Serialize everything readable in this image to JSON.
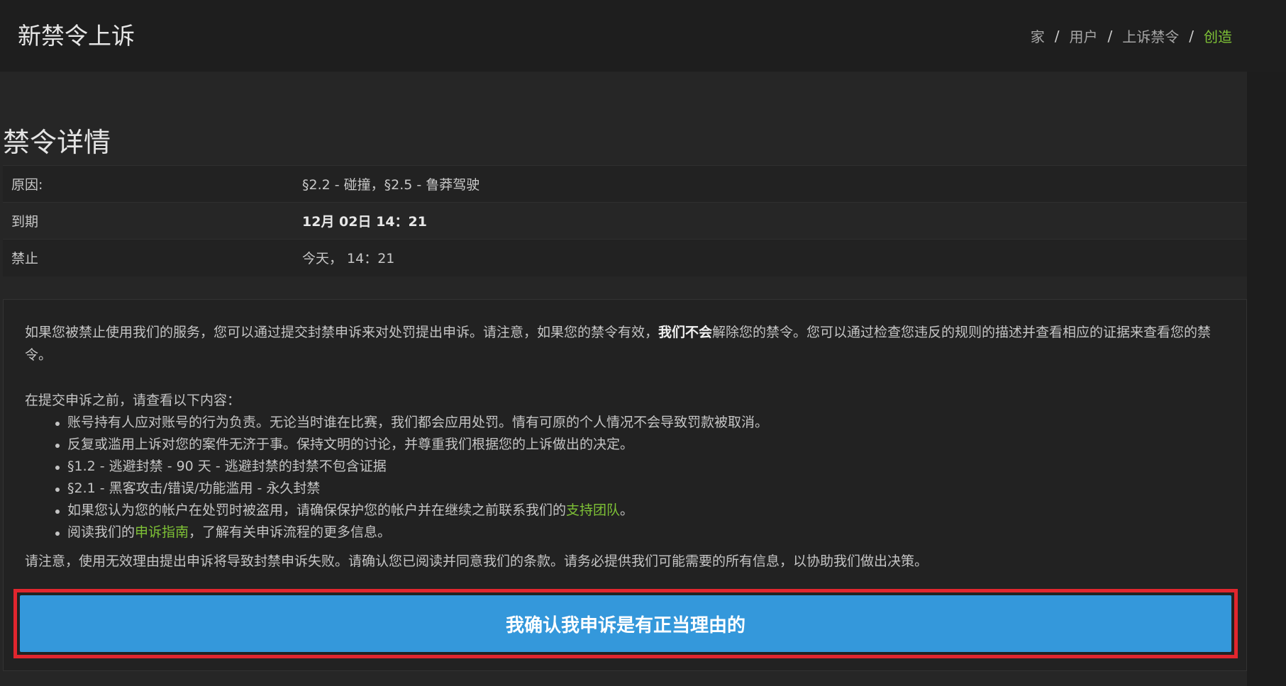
{
  "header": {
    "title": "新禁令上诉",
    "breadcrumb": [
      {
        "label": "家"
      },
      {
        "label": "用户"
      },
      {
        "label": "上诉禁令"
      },
      {
        "label": "创造"
      }
    ],
    "separator": "/"
  },
  "details": {
    "title": "禁令详情",
    "rows": [
      {
        "label": "原因:",
        "value": "§2.2 - 碰撞，§2.5 - 鲁莽驾驶"
      },
      {
        "label": "到期",
        "value": "12月 02日 14：21"
      },
      {
        "label": "禁止",
        "value": "今天， 14：21"
      }
    ]
  },
  "notice": {
    "intro_before": "如果您被禁止使用我们的服务，您可以通过提交封禁申诉来对处罚提出申诉。请注意，如果您的禁令有效，",
    "intro_bold": "我们不会",
    "intro_after": "解除您的禁令。您可以通过检查您违反的规则的描述并查看相应的证据来查看您的禁令。",
    "list_title": "在提交申诉之前，请查看以下内容：",
    "items": [
      "账号持有人应对账号的行为负责。无论当时谁在比赛，我们都会应用处罚。情有可原的个人情况不会导致罚款被取消。",
      "反复或滥用上诉对您的案件无济于事。保持文明的讨论，并尊重我们根据您的上诉做出的决定。",
      "§1.2 - 逃避封禁 - 90 天 - 逃避封禁的封禁不包含证据",
      "§2.1 - 黑客攻击/错误/功能滥用 - 永久封禁"
    ],
    "support_item": {
      "before": "如果您认为您的帐户在处罚时被盗用，请确保保护您的帐户并在继续之前联系我们的",
      "link": "支持团队",
      "after": "。"
    },
    "guide_item": {
      "before": "阅读我们的",
      "link": "申诉指南",
      "after": "，了解有关申诉流程的更多信息。"
    },
    "closing": "请注意，使用无效理由提出申诉将导致封禁申诉失败。请确认您已阅读并同意我们的条款。请务必提供我们可能需要的所有信息，以协助我们做出决策。"
  },
  "confirm_button": "我确认我申诉是有正当理由的",
  "colors": {
    "accent_green": "#7ec136",
    "button_blue": "#3498db",
    "highlight_red": "#e1262e"
  }
}
